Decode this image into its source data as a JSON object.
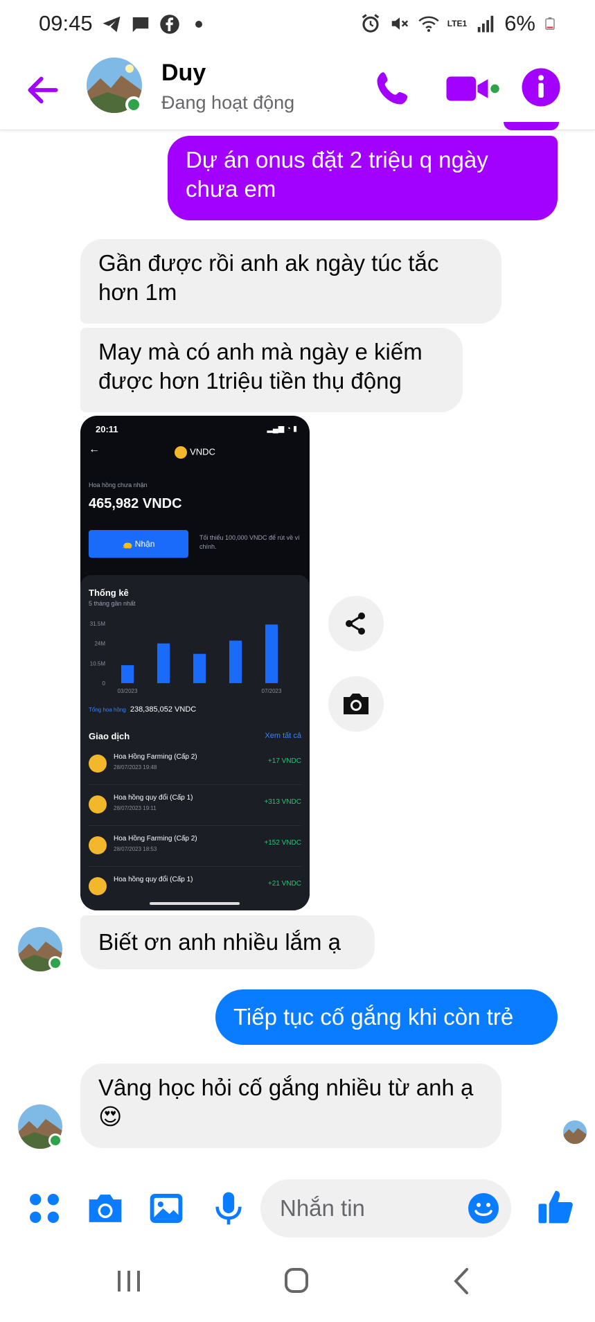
{
  "status_bar": {
    "time": "09:45",
    "battery": "6%",
    "network": "LTE1"
  },
  "header": {
    "name": "Duy",
    "status": "Đang hoạt động",
    "accent_color": "#a200ff"
  },
  "messages": [
    {
      "side": "out",
      "text": "Dự án onus đặt 2 triệu q ngày chưa em"
    },
    {
      "side": "in",
      "text": "Gần được rồi anh ak ngày túc tắc hơn 1m"
    },
    {
      "side": "in",
      "text": "May mà có anh mà ngày e kiếm được hơn 1triệu tiền thụ động"
    },
    {
      "side": "in",
      "text": "Biết ơn anh nhiều lắm ạ"
    },
    {
      "side": "out",
      "text": "Tiếp tục cố gắng khi còn trẻ"
    },
    {
      "side": "in",
      "text": "Vâng học hỏi cố gắng nhiều từ anh ạ😍"
    }
  ],
  "screenshot": {
    "time": "20:11",
    "title": "VNDC",
    "pending_label": "Hoa hồng chưa nhận",
    "amount": "465,982 VNDC",
    "claim_button": "Nhận",
    "min_note": "Tối thiểu 100,000 VNDC để rút về ví chính.",
    "stats_title": "Thống kê",
    "stats_subtitle": "5 tháng gần nhất",
    "total_label": "Tổng hoa hồng",
    "total_value": "238,385,052 VNDC",
    "transactions_title": "Giao dịch",
    "see_all": "Xem tất cả",
    "transactions": [
      {
        "name": "Hoa Hồng Farming (Cấp 2)",
        "date": "28/07/2023 19:48",
        "amount": "+17 VNDC"
      },
      {
        "name": "Hoa hồng quy đổi (Cấp 1)",
        "date": "28/07/2023 19:11",
        "amount": "+313 VNDC"
      },
      {
        "name": "Hoa Hồng Farming (Cấp 2)",
        "date": "28/07/2023 18:53",
        "amount": "+152 VNDC"
      },
      {
        "name": "Hoa hồng quy đổi (Cấp 1)",
        "date": "",
        "amount": "+21 VNDC"
      }
    ]
  },
  "chart_data": {
    "type": "bar",
    "categories": [
      "03/2023",
      "04/2023",
      "05/2023",
      "06/2023",
      "07/2023"
    ],
    "visible_x_ticks": [
      "03/2023",
      "07/2023"
    ],
    "values": [
      9.5,
      21,
      15.5,
      22.5,
      31
    ],
    "y_ticks": [
      "0",
      "10.5M",
      "24M",
      "31.5M"
    ],
    "ylim": [
      0,
      31.5
    ],
    "title": "Thống kê",
    "bar_color": "#1a6bfa"
  },
  "composer": {
    "placeholder": "Nhắn tin"
  }
}
